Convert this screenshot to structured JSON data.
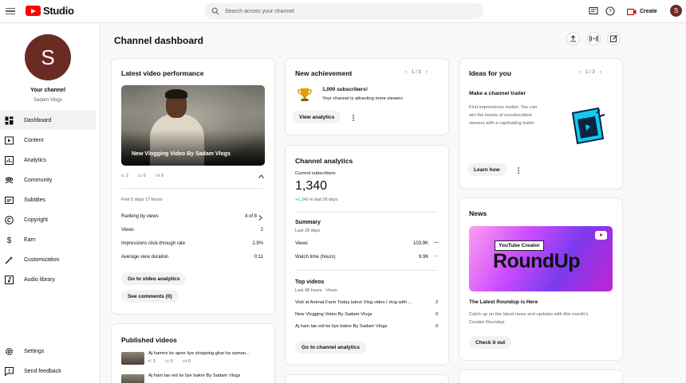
{
  "app": {
    "name": "Studio"
  },
  "search": {
    "placeholder": "Search across your channel"
  },
  "topbar": {
    "create_label": "Create",
    "avatar_letter": "S"
  },
  "sidebar": {
    "avatar_letter": "S",
    "your_channel": "Your channel",
    "channel_name": "Sadam Vlogs",
    "items": [
      {
        "label": "Dashboard",
        "icon": "dashboard-icon",
        "active": true
      },
      {
        "label": "Content",
        "icon": "content-icon"
      },
      {
        "label": "Analytics",
        "icon": "analytics-icon"
      },
      {
        "label": "Community",
        "icon": "community-icon"
      },
      {
        "label": "Subtitles",
        "icon": "subtitles-icon"
      },
      {
        "label": "Copyright",
        "icon": "copyright-icon"
      },
      {
        "label": "Earn",
        "icon": "earn-icon"
      },
      {
        "label": "Customization",
        "icon": "customization-icon"
      },
      {
        "label": "Audio library",
        "icon": "audio-library-icon"
      }
    ],
    "bottom": [
      {
        "label": "Settings",
        "icon": "gear-icon"
      },
      {
        "label": "Send feedback",
        "icon": "feedback-icon"
      }
    ]
  },
  "main": {
    "title": "Channel dashboard"
  },
  "latest_video": {
    "title": "Latest video performance",
    "video_title": "New Vlogging Video By Sadam Vlogs",
    "views": "2",
    "comments": "0",
    "likes": "0",
    "period": "First 5 days 17 hours",
    "rows": [
      {
        "label": "Ranking by views",
        "value": "4 of 8"
      },
      {
        "label": "Views",
        "value": "2"
      },
      {
        "label": "Impressions click-through rate",
        "value": "2.9%"
      },
      {
        "label": "Average view duration",
        "value": "0:11"
      }
    ],
    "btn_analytics": "Go to video analytics",
    "btn_comments": "See comments (0)"
  },
  "achievement": {
    "title": "New achievement",
    "pager": "1 / 3",
    "headline": "1,000 subscribers!",
    "sub": "Your channel is attracting more viewers",
    "btn": "View analytics"
  },
  "analytics": {
    "title": "Channel analytics",
    "subs_label": "Current subscribers",
    "subs_value": "1,340",
    "subs_change": "+1,340 in last 28 days",
    "summary_title": "Summary",
    "summary_period": "Last 28 days",
    "summary_rows": [
      {
        "label": "Views",
        "value": "103.9K",
        "trend": "—"
      },
      {
        "label": "Watch time (hours)",
        "value": "9.9K",
        "trend": "—"
      }
    ],
    "top_title": "Top videos",
    "top_period": "Last 48 hours · Views",
    "top_videos": [
      {
        "title": "Visit at Animal Farm Today latest Vlog video | vlog with ...",
        "views": "2"
      },
      {
        "title": "New Vlogging Video By Sadam Vlogs",
        "views": "0"
      },
      {
        "title": "Aj ham lae eid ke liye bakre By Sadam Vlogs",
        "views": "0"
      }
    ],
    "btn": "Go to channel analytics"
  },
  "ideas": {
    "title": "Ideas for you",
    "pager": "1 / 3",
    "headline": "Make a channel trailer",
    "body": [
      "First impressions matter. You can",
      "win the hearts of unsubscribed",
      "viewers with a captivating trailer"
    ],
    "btn": "Learn how"
  },
  "news": {
    "title": "News",
    "badge": "YouTube Creator",
    "big_text": "RoundUp",
    "headline": "The Latest Roundup is Here",
    "body": [
      "Catch up on the latest news and updates with this month's",
      "Creator Roundup"
    ],
    "btn": "Check it out"
  },
  "published": {
    "title": "Published videos",
    "items": [
      {
        "title": "Aj hamne ke apne liye shopping ghar ka saman...",
        "views": "1",
        "comments": "0",
        "likes": "0"
      },
      {
        "title": "Aj ham lae eid ke liye bakre By Sadam Vlogs",
        "views": "",
        "comments": "",
        "likes": ""
      }
    ]
  }
}
